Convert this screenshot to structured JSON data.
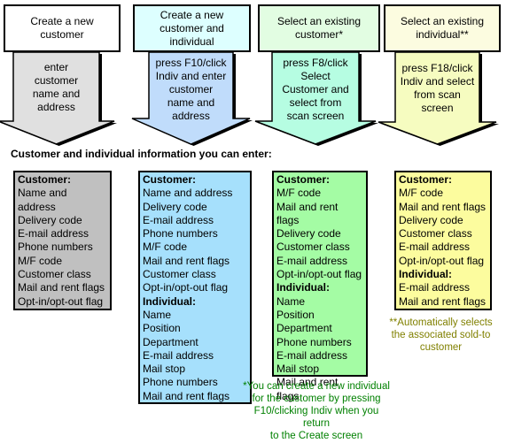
{
  "columns": [
    {
      "id": "new-customer",
      "title": "Create a new customer",
      "title_lines": [
        "Create a new",
        "customer"
      ],
      "action_lines": [
        "enter",
        "customer",
        "name and",
        "address"
      ],
      "head_color": "#ffffff",
      "arrow_color": "#e0e0e0",
      "info_color": "#c0c0c0",
      "info": [
        {
          "type": "header",
          "text": "Customer:"
        },
        {
          "type": "item",
          "text": "Name and"
        },
        {
          "type": "item",
          "text": "address"
        },
        {
          "type": "item",
          "text": "Delivery code"
        },
        {
          "type": "item",
          "text": "E-mail address"
        },
        {
          "type": "item",
          "text": "Phone numbers"
        },
        {
          "type": "item",
          "text": "M/F code"
        },
        {
          "type": "item",
          "text": "Customer class"
        },
        {
          "type": "item",
          "text": "Mail and rent flags"
        },
        {
          "type": "item",
          "text": "Opt-in/opt-out flag"
        }
      ]
    },
    {
      "id": "new-customer-individual",
      "title": "Create a new customer and individual",
      "title_lines": [
        "Create a new",
        "customer and",
        "individual"
      ],
      "action_lines": [
        "press F10/click",
        "Indiv and enter",
        "customer",
        "name and",
        "address"
      ],
      "head_color": "#ddffff",
      "arrow_color": "#c0dcfb",
      "info_color": "#a6e0fc",
      "info": [
        {
          "type": "header",
          "text": "Customer:"
        },
        {
          "type": "item",
          "text": "Name and address"
        },
        {
          "type": "item",
          "text": "Delivery code"
        },
        {
          "type": "item",
          "text": "E-mail address"
        },
        {
          "type": "item",
          "text": "Phone numbers"
        },
        {
          "type": "item",
          "text": "M/F code"
        },
        {
          "type": "item",
          "text": "Mail and rent flags"
        },
        {
          "type": "item",
          "text": "Customer class"
        },
        {
          "type": "item",
          "text": "Opt-in/opt-out flag"
        },
        {
          "type": "header",
          "text": "Individual:"
        },
        {
          "type": "item",
          "text": "Name"
        },
        {
          "type": "item",
          "text": "Position"
        },
        {
          "type": "item",
          "text": "Department"
        },
        {
          "type": "item",
          "text": "E-mail address"
        },
        {
          "type": "item",
          "text": "Mail stop"
        },
        {
          "type": "item",
          "text": "Phone numbers"
        },
        {
          "type": "item",
          "text": "Mail and rent flags"
        }
      ]
    },
    {
      "id": "existing-customer",
      "title": "Select an existing customer*",
      "title_lines": [
        "Select an existing",
        "customer*"
      ],
      "action_lines": [
        "press F8/click",
        "Select",
        "Customer and",
        "select from",
        "scan screen"
      ],
      "head_color": "#e2fde2",
      "arrow_color": "#b6fde2",
      "info_color": "#a4fca4",
      "info": [
        {
          "type": "header",
          "text": "Customer:"
        },
        {
          "type": "item",
          "text": "M/F code"
        },
        {
          "type": "item",
          "text": "Mail and rent flags"
        },
        {
          "type": "item",
          "text": "Delivery code"
        },
        {
          "type": "item",
          "text": "Customer class"
        },
        {
          "type": "item",
          "text": "E-mail address"
        },
        {
          "type": "item",
          "text": "Opt-in/opt-out flag"
        },
        {
          "type": "header",
          "text": "Individual:"
        },
        {
          "type": "item",
          "text": "Name"
        },
        {
          "type": "item",
          "text": "Position"
        },
        {
          "type": "item",
          "text": "Department"
        },
        {
          "type": "item",
          "text": "Phone numbers"
        },
        {
          "type": "item",
          "text": "E-mail address"
        },
        {
          "type": "item",
          "text": "Mail stop"
        },
        {
          "type": "item",
          "text": "Mail and rent flags"
        }
      ],
      "note_lines": [
        "*You can create a new individual",
        "for the customer by pressing",
        "F10/clicking Indiv when you return",
        "to the Create screen"
      ],
      "note_color": "#008000"
    },
    {
      "id": "existing-individual",
      "title": "Select an existing individual**",
      "title_lines": [
        "Select an existing",
        "individual**"
      ],
      "action_lines": [
        "press F18/click",
        "Indiv and select",
        "from scan",
        "screen"
      ],
      "head_color": "#fcfce0",
      "arrow_color": "#f6fcc0",
      "info_color": "#fcfc9e",
      "info": [
        {
          "type": "header",
          "text": "Customer:"
        },
        {
          "type": "item",
          "text": "M/F code"
        },
        {
          "type": "item",
          "text": "Mail and rent flags"
        },
        {
          "type": "item",
          "text": "Delivery code"
        },
        {
          "type": "item",
          "text": "Customer class"
        },
        {
          "type": "item",
          "text": "E-mail address"
        },
        {
          "type": "item",
          "text": "Opt-in/opt-out flag"
        },
        {
          "type": "header",
          "text": "Individual:"
        },
        {
          "type": "item",
          "text": "E-mail address"
        },
        {
          "type": "item",
          "text": "Mail and rent flags"
        }
      ],
      "note_lines": [
        "**Automatically selects",
        "the associated sold-to",
        "customer"
      ],
      "note_color": "#808000"
    }
  ],
  "section_title": "Customer and individual information you can enter:"
}
